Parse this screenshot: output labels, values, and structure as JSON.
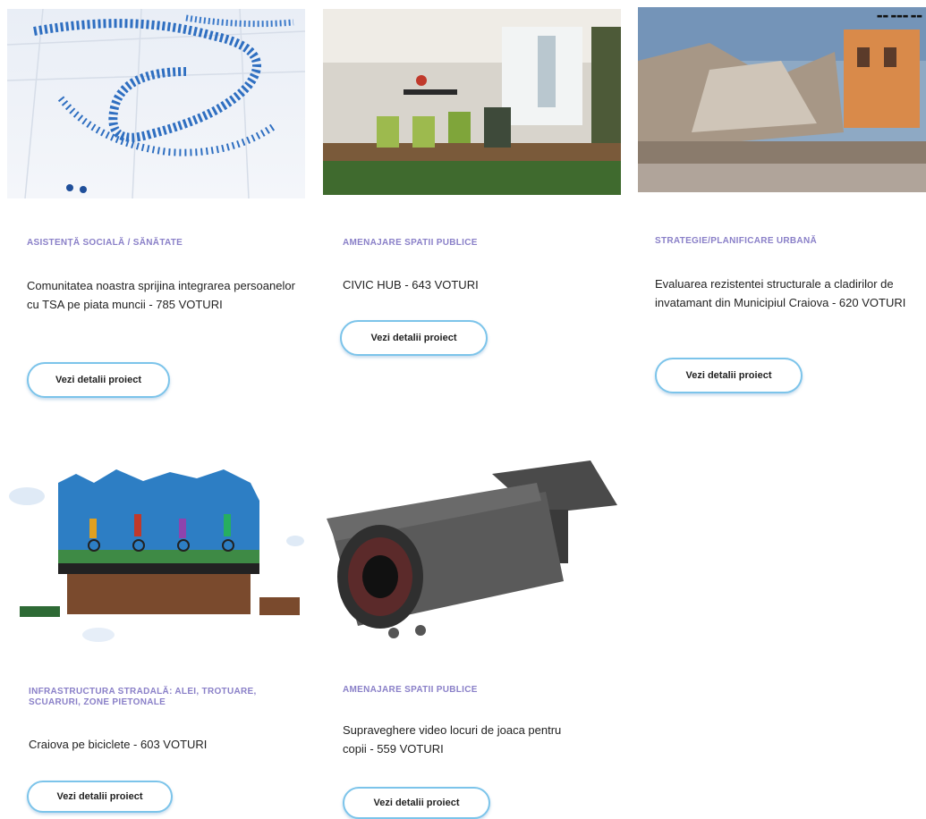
{
  "projects": [
    {
      "category": "ASISTENȚĂ SOCIALĂ / SĂNĂTATE",
      "title": "Comunitatea noastra sprijina integrarea persoanelor cu TSA pe piata muncii - 785 VOTURI",
      "button": "Vezi detalii proiect",
      "image": "crowd-forming-heart-photo"
    },
    {
      "category": "AMENAJARE SPATII PUBLICE",
      "title": "CIVIC HUB - 643 VOTURI",
      "button": "Vezi detalii proiect",
      "image": "coworking-office-photo"
    },
    {
      "category": "STRATEGIE/PLANIFICARE URBANĂ",
      "title": "Evaluarea rezistentei structurale a cladirilor de invatamant din Municipiul Craiova - 620 VOTURI",
      "button": "Vezi detalii proiect",
      "image": "collapsed-building-photo"
    },
    {
      "category": "INFRASTRUCTURA STRADALĂ: ALEI, TROTUARE, SCUARURI, ZONE PIETONALE",
      "title": "Craiova pe biciclete - 603 VOTURI",
      "button": "Vezi detalii proiect",
      "image": "cyclists-illustration"
    },
    {
      "category": "AMENAJARE SPATII PUBLICE",
      "title": "Supraveghere video locuri de joaca pentru copii - 559 VOTURI",
      "button": "Vezi detalii proiect",
      "image": "security-camera-photo"
    }
  ],
  "colors": {
    "category": "#8a80c8",
    "button_border": "#7cc4ea",
    "text": "#222222"
  }
}
